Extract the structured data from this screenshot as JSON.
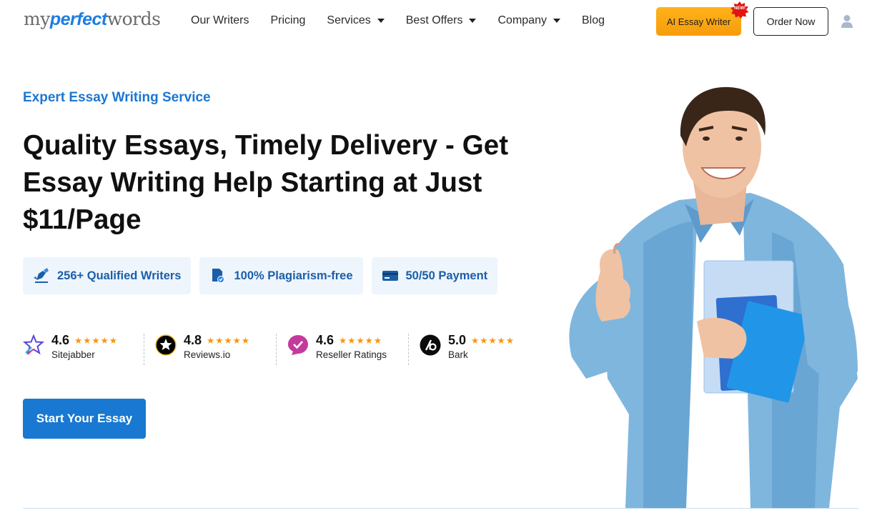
{
  "logo": {
    "part1": "my",
    "part2": "perfect",
    "part3": "words"
  },
  "nav": {
    "items": [
      {
        "label": "Our Writers",
        "dropdown": false
      },
      {
        "label": "Pricing",
        "dropdown": false
      },
      {
        "label": "Services",
        "dropdown": true
      },
      {
        "label": "Best Offers",
        "dropdown": true
      },
      {
        "label": "Company",
        "dropdown": true
      },
      {
        "label": "Blog",
        "dropdown": false
      }
    ]
  },
  "header": {
    "ai_button": "AI Essay Writer",
    "new_badge": "NEW!",
    "order_button": "Order Now",
    "user_icon": "user-icon"
  },
  "hero": {
    "eyebrow": "Expert Essay Writing Service",
    "headline": "Quality Essays, Timely Delivery - Get Essay Writing Help Starting at Just $11/Page",
    "features": [
      {
        "icon": "writer-icon",
        "label": "256+ Qualified Writers"
      },
      {
        "icon": "document-check-icon",
        "label": "100% Plagiarism-free"
      },
      {
        "icon": "credit-card-icon",
        "label": "50/50 Payment"
      }
    ],
    "ratings": [
      {
        "score": "4.6",
        "stars": "★★★★★",
        "source": "Sitejabber",
        "icon": "sitejabber-icon"
      },
      {
        "score": "4.8",
        "stars": "★★★★★",
        "source": "Reviews.io",
        "icon": "reviewsio-icon"
      },
      {
        "score": "4.6",
        "stars": "★★★★★",
        "source": "Reseller Ratings",
        "icon": "resellerratings-icon"
      },
      {
        "score": "5.0",
        "stars": "★★★★★",
        "source": "Bark",
        "icon": "bark-icon"
      }
    ],
    "cta": "Start Your Essay"
  },
  "colors": {
    "brand_blue": "#1878d2",
    "accent_orange": "#f79c0b",
    "star_orange": "#f59618",
    "feature_bg": "#eef5fc"
  }
}
